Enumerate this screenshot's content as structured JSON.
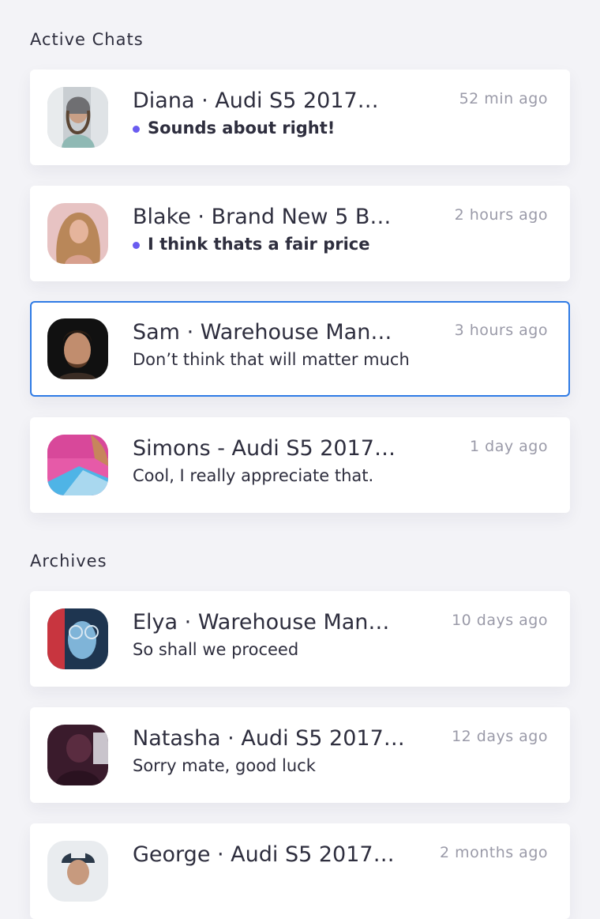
{
  "sections": {
    "active_title": "Active Chats",
    "archives_title": "Archives"
  },
  "chats": [
    {
      "name": "Diana · Audi S5 2017…",
      "message": "Sounds about right!",
      "time": "52 min ago",
      "unread": true
    },
    {
      "name": "Blake · Brand New 5 B…",
      "message": "I think thats a fair price",
      "time": "2 hours ago",
      "unread": true
    },
    {
      "name": "Sam · Warehouse Man…",
      "message": "Don’t think that will matter much",
      "time": "3 hours ago",
      "unread": false,
      "selected": true
    },
    {
      "name": "Simons - Audi S5 2017…",
      "message": "Cool, I really appreciate that.",
      "time": "1 day ago",
      "unread": false
    }
  ],
  "archives": [
    {
      "name": "Elya · Warehouse Man…",
      "message": "So shall we proceed",
      "time": "10 days ago"
    },
    {
      "name": "Natasha · Audi S5 2017…",
      "message": "Sorry mate, good luck",
      "time": "12 days ago"
    },
    {
      "name": "George · Audi S5 2017…",
      "message": "",
      "time": "2 months ago"
    }
  ],
  "colors": {
    "accent_dot": "#6a5cf0",
    "selection_border": "#2f7be5",
    "timestamp": "#9a9aa8"
  }
}
